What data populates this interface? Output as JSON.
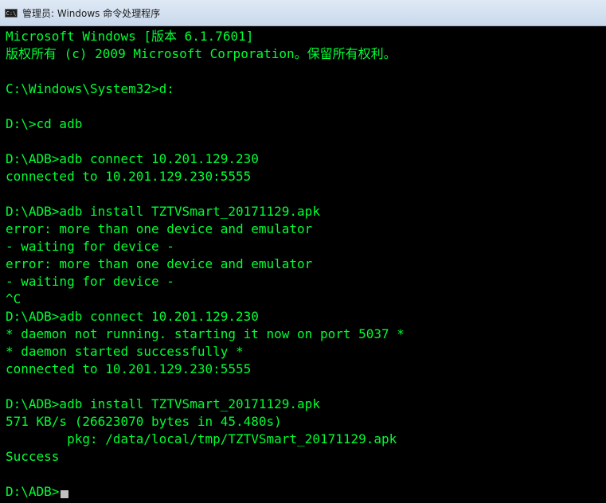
{
  "window": {
    "title": "管理员: Windows 命令处理程序",
    "icon_label": "C:\\"
  },
  "console": {
    "text_color": "#00ff33",
    "background": "#000000",
    "lines": [
      "Microsoft Windows [版本 6.1.7601]",
      "版权所有 (c) 2009 Microsoft Corporation。保留所有权利。",
      "",
      "C:\\Windows\\System32>d:",
      "",
      "D:\\>cd adb",
      "",
      "D:\\ADB>adb connect 10.201.129.230",
      "connected to 10.201.129.230:5555",
      "",
      "D:\\ADB>adb install TZTVSmart_20171129.apk",
      "error: more than one device and emulator",
      "- waiting for device -",
      "error: more than one device and emulator",
      "- waiting for device -",
      "^C",
      "D:\\ADB>adb connect 10.201.129.230",
      "* daemon not running. starting it now on port 5037 *",
      "* daemon started successfully *",
      "connected to 10.201.129.230:5555",
      "",
      "D:\\ADB>adb install TZTVSmart_20171129.apk",
      "571 KB/s (26623070 bytes in 45.480s)",
      "        pkg: /data/local/tmp/TZTVSmart_20171129.apk",
      "Success",
      ""
    ],
    "prompt": "D:\\ADB>"
  }
}
